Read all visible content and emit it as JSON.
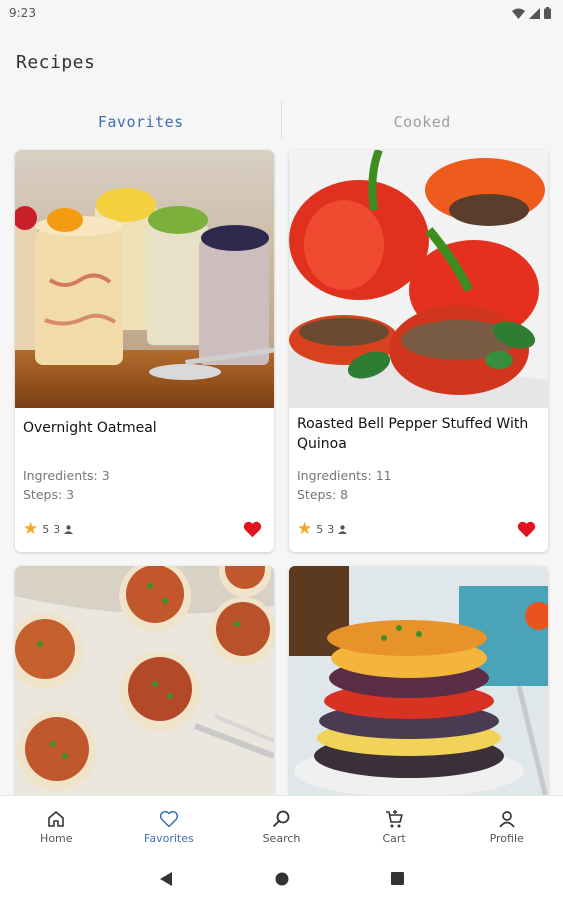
{
  "status_bar": {
    "time": "9:23"
  },
  "app": {
    "title": "Recipes"
  },
  "tabs": [
    {
      "label": "Favorites",
      "active": true
    },
    {
      "label": "Cooked",
      "active": false
    }
  ],
  "recipes": [
    {
      "title": "Overnight Oatmeal",
      "ingredients": "Ingredients: 3",
      "steps": "Steps: 3",
      "rating": "5",
      "cooks": "3",
      "favorite": true,
      "image": "jars-of-oatmeal"
    },
    {
      "title": "Roasted Bell Pepper Stuffed With Quinoa",
      "ingredients": "Ingredients: 11",
      "steps": "Steps: 8",
      "rating": "5",
      "cooks": "3",
      "favorite": true,
      "image": "stuffed-red-peppers"
    },
    {
      "image": "stuffed-mushrooms"
    },
    {
      "image": "vegetable-stack"
    }
  ],
  "bottom_nav": [
    {
      "label": "Home",
      "icon": "home-icon",
      "active": false
    },
    {
      "label": "Favorites",
      "icon": "heart-icon",
      "active": true
    },
    {
      "label": "Search",
      "icon": "search-icon",
      "active": false
    },
    {
      "label": "Cart",
      "icon": "cart-icon",
      "active": false
    },
    {
      "label": "Profile",
      "icon": "profile-icon",
      "active": false
    }
  ],
  "colors": {
    "accent": "#3f6fb6",
    "heart": "#e0141e",
    "star": "#f5a623"
  }
}
